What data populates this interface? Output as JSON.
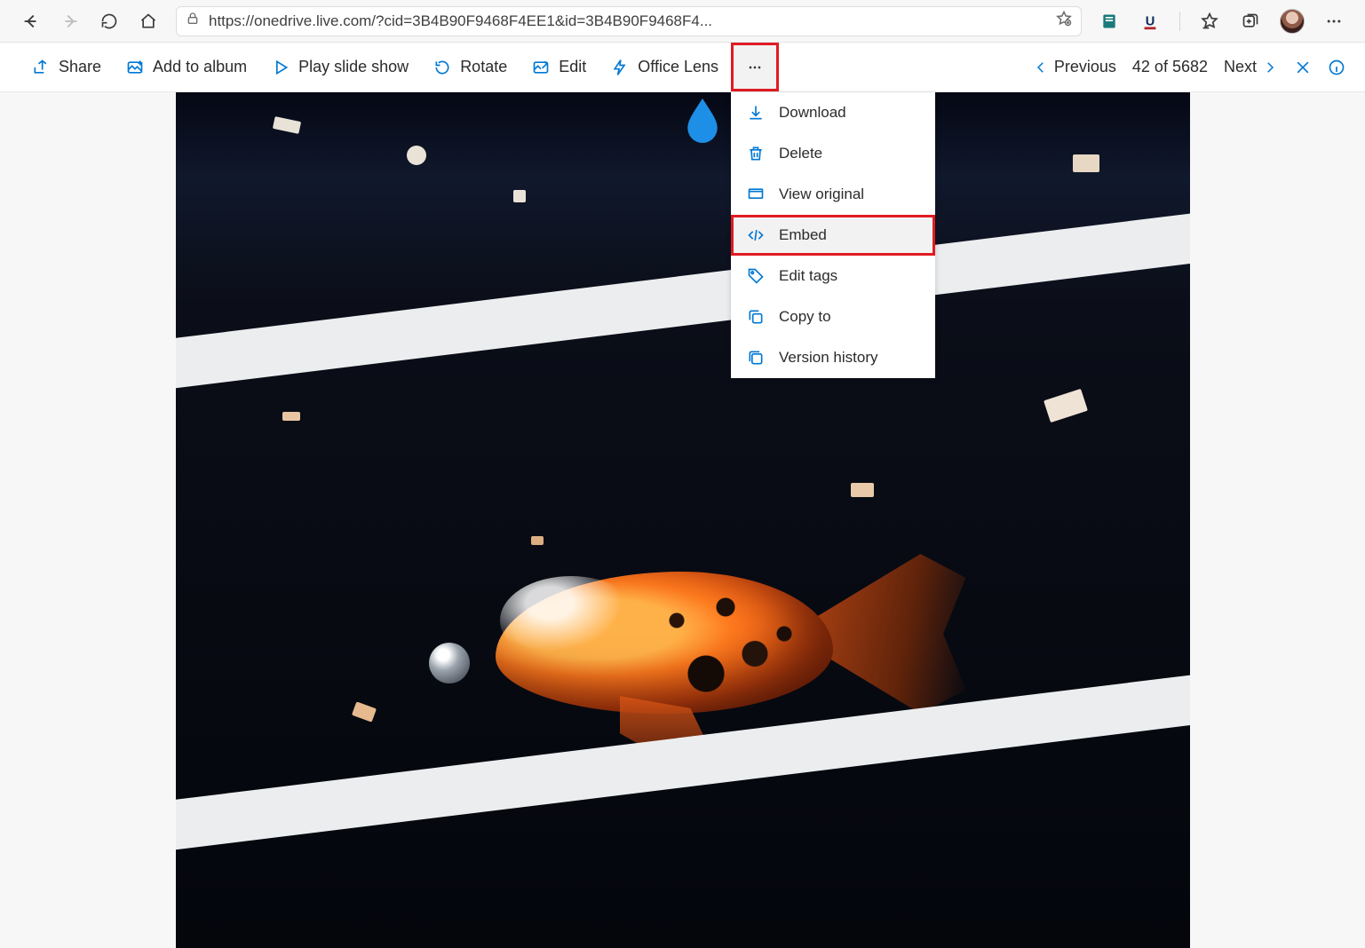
{
  "browser": {
    "url": "https://onedrive.live.com/?cid=3B4B90F9468F4EE1&id=3B4B90F9468F4..."
  },
  "toolbar": {
    "share": "Share",
    "add_to_album": "Add to album",
    "slideshow": "Play slide show",
    "rotate": "Rotate",
    "edit": "Edit",
    "office_lens": "Office Lens"
  },
  "menu": {
    "download": "Download",
    "delete": "Delete",
    "view_original": "View original",
    "embed": "Embed",
    "edit_tags": "Edit tags",
    "copy_to": "Copy to",
    "version_history": "Version history"
  },
  "pager": {
    "previous": "Previous",
    "next": "Next",
    "counter": "42 of 5682"
  }
}
